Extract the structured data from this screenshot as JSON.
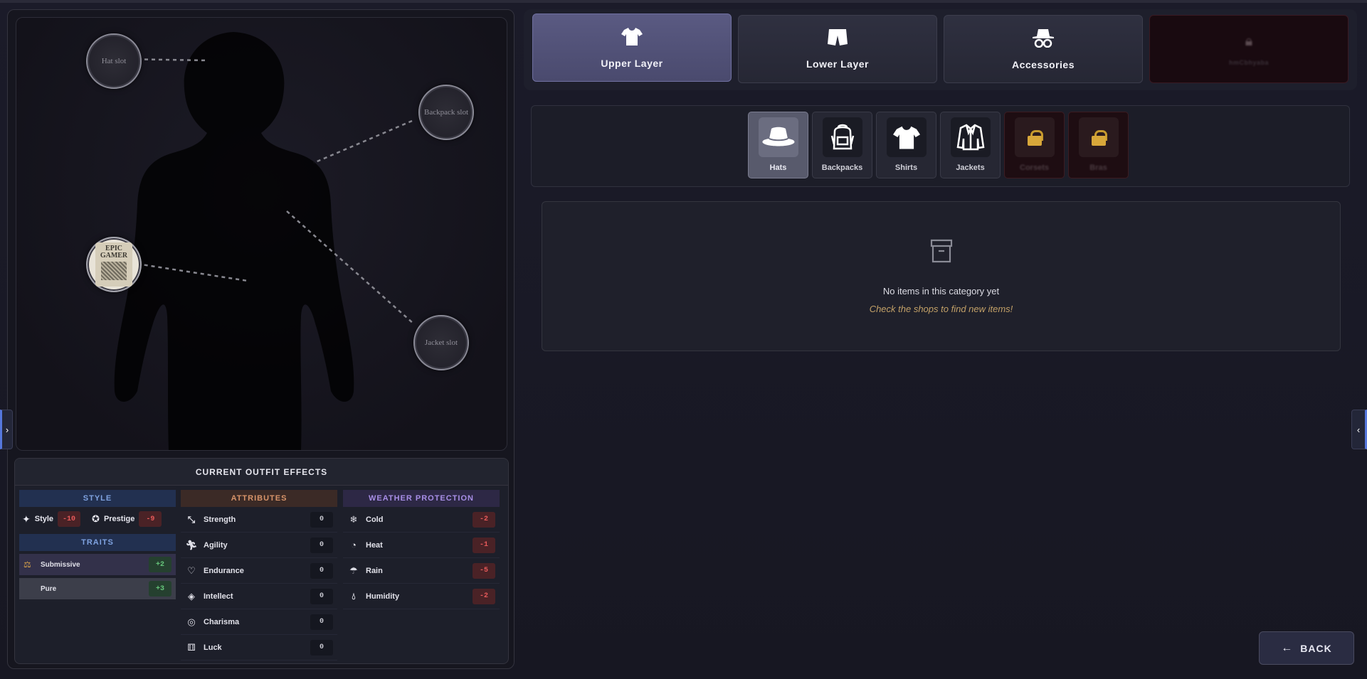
{
  "slots": {
    "hat": "Hat slot",
    "backpack": "Backpack slot",
    "jacket": "Jacket slot",
    "shirt_text": "EPIC GAMER"
  },
  "effects": {
    "title": "CURRENT OUTFIT EFFECTS",
    "style": {
      "header": "STYLE",
      "items": [
        {
          "label": "Style",
          "value": "-10",
          "icon": "sparkle-icon"
        },
        {
          "label": "Prestige",
          "value": "-9",
          "icon": "award-icon"
        }
      ]
    },
    "traits": {
      "header": "TRAITS",
      "items": [
        {
          "label": "Submissive",
          "value": "+2",
          "icon": "scales-icon"
        },
        {
          "label": "Pure",
          "value": "+3"
        }
      ]
    },
    "attributes": {
      "header": "ATTRIBUTES",
      "items": [
        {
          "label": "Strength",
          "value": "0",
          "icon": "strength-icon"
        },
        {
          "label": "Agility",
          "value": "0",
          "icon": "running-icon"
        },
        {
          "label": "Endurance",
          "value": "0",
          "icon": "heart-pulse-icon"
        },
        {
          "label": "Intellect",
          "value": "0",
          "icon": "graduation-cap-icon"
        },
        {
          "label": "Charisma",
          "value": "0",
          "icon": "charisma-icon"
        },
        {
          "label": "Luck",
          "value": "0",
          "icon": "dice-icon"
        }
      ]
    },
    "weather": {
      "header": "WEATHER PROTECTION",
      "items": [
        {
          "label": "Cold",
          "value": "-2",
          "icon": "snowflake-icon"
        },
        {
          "label": "Heat",
          "value": "-1",
          "icon": "heat-icon"
        },
        {
          "label": "Rain",
          "value": "-5",
          "icon": "umbrella-icon"
        },
        {
          "label": "Humidity",
          "value": "-2",
          "icon": "droplet-icon"
        }
      ]
    }
  },
  "tabs": [
    {
      "label": "Upper Layer",
      "icon": "tshirt-icon",
      "active": true
    },
    {
      "label": "Lower Layer",
      "icon": "shorts-icon"
    },
    {
      "label": "Accessories",
      "icon": "hat-glasses-icon"
    },
    {
      "label": "hmCbhyaba",
      "icon": "locked-icon",
      "locked": true
    }
  ],
  "subtabs": [
    {
      "label": "Hats",
      "icon": "hat-icon",
      "active": true
    },
    {
      "label": "Backpacks",
      "icon": "backpack-icon"
    },
    {
      "label": "Shirts",
      "icon": "shirt-icon"
    },
    {
      "label": "Jackets",
      "icon": "jacket-icon"
    },
    {
      "label": "Corsets",
      "icon": "lock-icon",
      "locked": true
    },
    {
      "label": "Bras",
      "icon": "lock-icon",
      "locked": true
    }
  ],
  "empty": {
    "title": "No items in this category yet",
    "hint": "Check the shops to find new items!"
  },
  "back_label": "BACK",
  "colors": {
    "accent": "#5a5a82",
    "negative": "#e85a5a",
    "positive": "#67c77c",
    "hint": "#c2a067"
  }
}
